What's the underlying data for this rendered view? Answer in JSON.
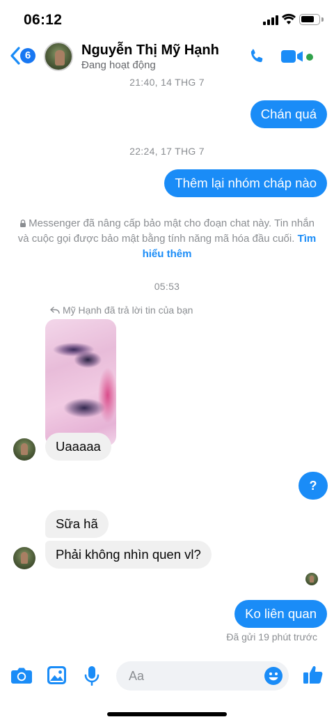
{
  "status_bar": {
    "time": "06:12"
  },
  "header": {
    "unread_count": "6",
    "contact_name": "Nguyễn Thị Mỹ Hạnh",
    "contact_status": "Đang hoạt động"
  },
  "messages": {
    "ts1": "21:40, 14 THG 7",
    "out1": "Chán quá",
    "ts2": "22:24, 17 THG 7",
    "out2": "Thêm lại nhóm cháp nào",
    "security_text": "Messenger đã nâng cấp bảo mật cho đoạn chat này. Tin nhắn và cuộc gọi được bảo mật bằng tính năng mã hóa đầu cuối.",
    "security_link": "Tìm hiểu thêm",
    "ts3": "05:53",
    "reply_note": "Mỹ Hạnh đã trả lời tin của bạn",
    "in1": "Uaaaaa",
    "out3": "?",
    "in2": "Sữa hã",
    "in3": "Phải không nhìn quen vl?",
    "out4": "Ko liên quan",
    "sent_status": "Đã gửi 19 phút trước"
  },
  "composer": {
    "placeholder": "Aa"
  },
  "colors": {
    "accent": "#1a8cf7",
    "active": "#31a24c",
    "incoming_bg": "#f0f0f0"
  }
}
